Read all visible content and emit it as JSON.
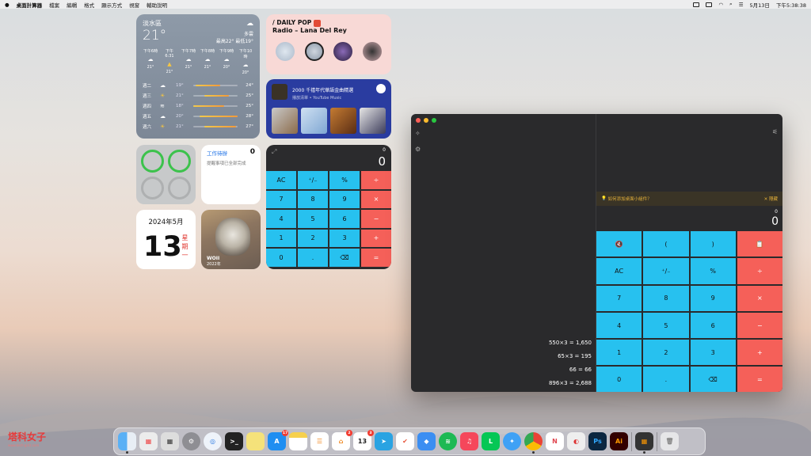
{
  "menubar": {
    "app": "桌面計算器",
    "items": [
      "檔案",
      "編輯",
      "格式",
      "顯示方式",
      "視窗",
      "輔助說明"
    ],
    "date": "5月13日",
    "time": "下午5:38:38"
  },
  "weather": {
    "city": "淡水區",
    "temp": "21°",
    "condition": "多雲",
    "range": "最高22° 最低19°",
    "hours": [
      {
        "t": "下午6時",
        "v": "21°"
      },
      {
        "t": "下午6:31",
        "v": "21°"
      },
      {
        "t": "下午7時",
        "v": "21°"
      },
      {
        "t": "下午8時",
        "v": "21°"
      },
      {
        "t": "下午9時",
        "v": "20°"
      },
      {
        "t": "下午10時",
        "v": "20°"
      }
    ],
    "days": [
      {
        "d": "週二",
        "lo": "19°",
        "hi": "24°"
      },
      {
        "d": "週三",
        "lo": "21°",
        "hi": "25°"
      },
      {
        "d": "週四",
        "lo": "18°",
        "hi": "25°"
      },
      {
        "d": "週五",
        "lo": "20°",
        "hi": "28°"
      },
      {
        "d": "週六",
        "lo": "21°",
        "hi": "27°"
      }
    ]
  },
  "music": {
    "line1": "/ DAILY POP",
    "line2": "Radio – Lana Del Rey"
  },
  "ytm": {
    "title": "2000 千禧年代華語金曲精選",
    "subtitle": "播放清單 • YouTube Music"
  },
  "reminder": {
    "title": "工作待辦",
    "count": "0",
    "status": "提醒事項已全部完成"
  },
  "calendar": {
    "ym": "2024年5月",
    "day": "13",
    "weekday": "星期一"
  },
  "photo": {
    "title": "WOII",
    "date": "2022年"
  },
  "calc_widget": {
    "expr": "0",
    "value": "0",
    "keys": [
      "AC",
      "⁺∕₋",
      "%",
      "÷",
      "7",
      "8",
      "9",
      "×",
      "4",
      "5",
      "6",
      "−",
      "1",
      "2",
      "3",
      "+",
      "0",
      ".",
      "⌫",
      "="
    ]
  },
  "calc_window": {
    "banner": "如何添加桌面小組件？",
    "banner_close": "✕ 隱藏",
    "expr": "0",
    "value": "0",
    "history": [
      "550×3 = 1,650",
      "65×3 = 195",
      "66 = 66",
      "896×3 = 2,688"
    ],
    "keys": [
      "🔇",
      "(",
      ")",
      "📋",
      "AC",
      "⁺∕₋",
      "%",
      "÷",
      "7",
      "8",
      "9",
      "×",
      "4",
      "5",
      "6",
      "−",
      "1",
      "2",
      "3",
      "+",
      "0",
      ".",
      "⌫",
      "="
    ]
  },
  "dock": {
    "calendar_day": "13",
    "badges": {
      "appstore": "17",
      "home": "2",
      "calendar": "3"
    }
  },
  "watermark": {
    "name": "塔科女子",
    "url": "www.tech-girlz.com"
  }
}
